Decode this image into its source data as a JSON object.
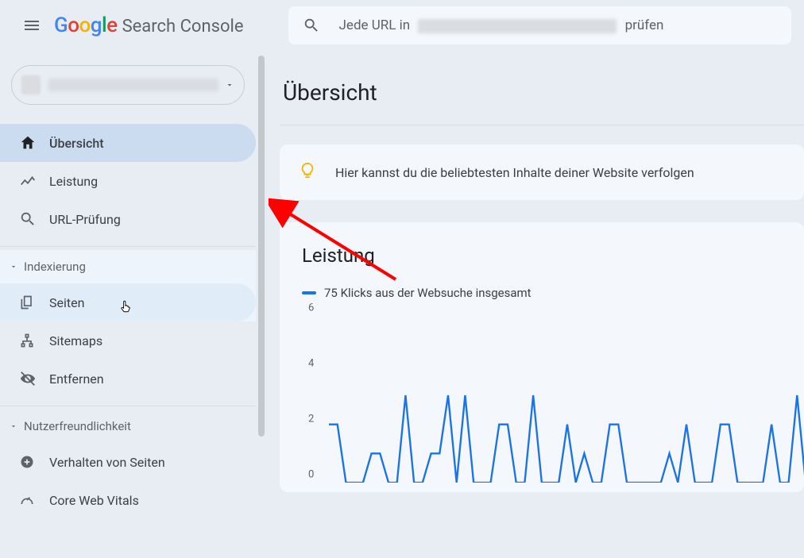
{
  "header": {
    "app_name": "Search Console",
    "search_prefix": "Jede URL in",
    "search_suffix": "prüfen"
  },
  "sidebar": {
    "items": [
      {
        "label": "Übersicht"
      },
      {
        "label": "Leistung"
      },
      {
        "label": "URL-Prüfung"
      }
    ],
    "group_indexing_label": "Indexierung",
    "indexing_items": [
      {
        "label": "Seiten"
      },
      {
        "label": "Sitemaps"
      },
      {
        "label": "Entfernen"
      }
    ],
    "group_ux_label": "Nutzerfreundlichkeit",
    "ux_items": [
      {
        "label": "Verhalten von Seiten"
      },
      {
        "label": "Core Web Vitals"
      }
    ]
  },
  "main": {
    "page_title": "Übersicht",
    "hint_text": "Hier kannst du die beliebtesten Inhalte deiner Website verfolgen",
    "perf_title": "Leistung",
    "legend_text": "75 Klicks aus der Websuche insgesamt"
  },
  "chart_data": {
    "type": "line",
    "title": "Leistung",
    "legend": "75 Klicks aus der Websuche insgesamt",
    "ylabel": "",
    "xlabel": "",
    "ylim": [
      0,
      6
    ],
    "y_ticks": [
      0,
      2,
      4,
      6
    ],
    "values": [
      2,
      2,
      0,
      0,
      0,
      1,
      1,
      0,
      0,
      3,
      0,
      0,
      1,
      1,
      3,
      0,
      3,
      0,
      0,
      0,
      2,
      2,
      0,
      0,
      3,
      0,
      0,
      0,
      2,
      0,
      1,
      0,
      0,
      2,
      2,
      0,
      0,
      0,
      0,
      0,
      1,
      0,
      2,
      0,
      0,
      0,
      2,
      2,
      0,
      0,
      0,
      0,
      2,
      0,
      0,
      3,
      0
    ]
  }
}
